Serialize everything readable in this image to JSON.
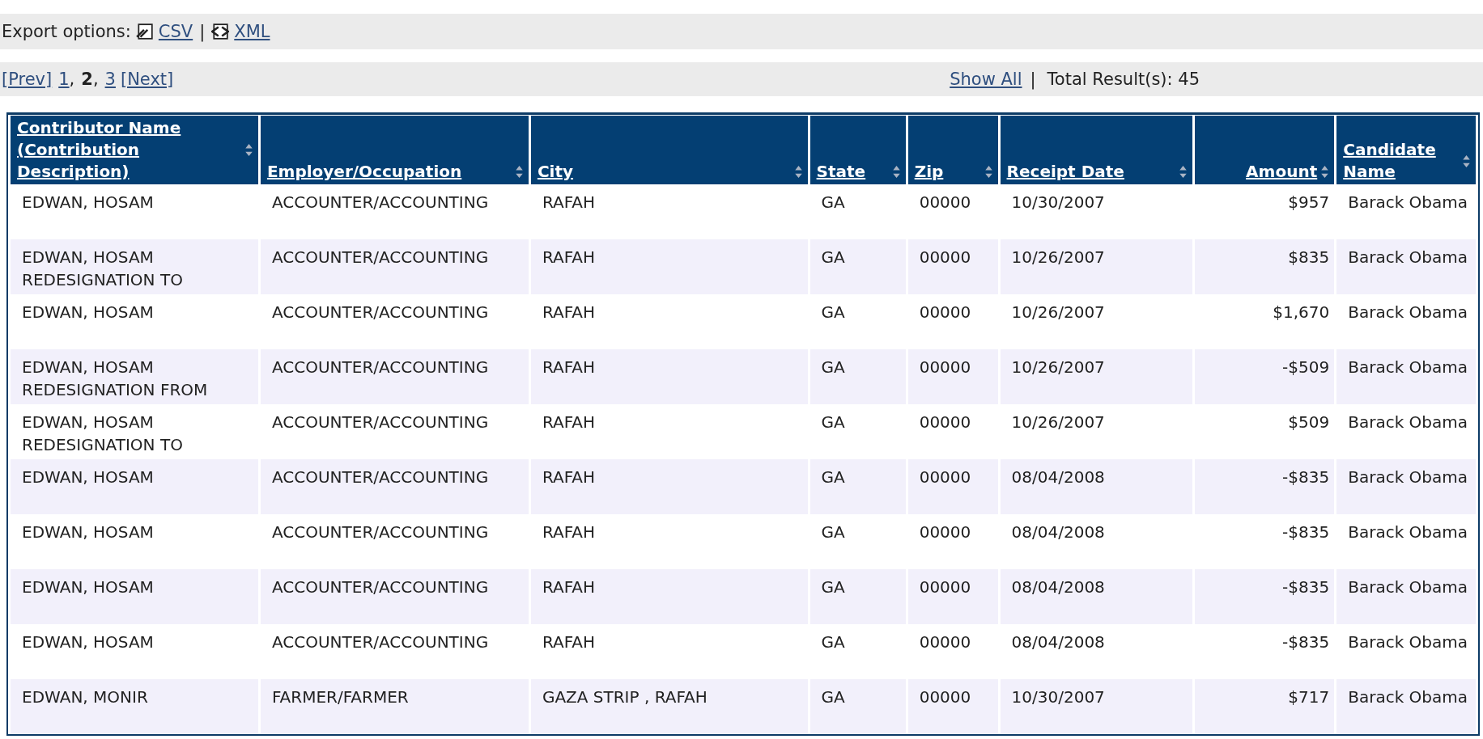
{
  "export_bar": {
    "label": "Export options:",
    "links": [
      {
        "kind": "csv",
        "label": "CSV"
      },
      {
        "kind": "xml",
        "label": "XML"
      }
    ],
    "separator": "|"
  },
  "pager": {
    "prev": "[Prev]",
    "next": "[Next]",
    "page_separator": ",",
    "pages": [
      {
        "label": "1",
        "selected": false
      },
      {
        "label": "2",
        "selected": true
      },
      {
        "label": "3",
        "selected": false
      }
    ],
    "show_all": "Show All",
    "separator": "|",
    "total": "Total Result(s): 45"
  },
  "table": {
    "columns": [
      "Contributor Name (Contribution Description)",
      "Employer/Occupation",
      "City",
      "State",
      "Zip",
      "Receipt Date",
      "Amount",
      "Candidate Name"
    ],
    "rows": [
      [
        "EDWAN, HOSAM",
        "ACCOUNTER/ACCOUNTING",
        "RAFAH",
        "GA",
        "00000",
        "10/30/2007",
        "$957",
        "Barack Obama"
      ],
      [
        "EDWAN, HOSAM REDESIGNATION TO",
        "ACCOUNTER/ACCOUNTING",
        "RAFAH",
        "GA",
        "00000",
        "10/26/2007",
        "$835",
        "Barack Obama"
      ],
      [
        "EDWAN, HOSAM",
        "ACCOUNTER/ACCOUNTING",
        "RAFAH",
        "GA",
        "00000",
        "10/26/2007",
        "$1,670",
        "Barack Obama"
      ],
      [
        "EDWAN, HOSAM REDESIGNATION FROM",
        "ACCOUNTER/ACCOUNTING",
        "RAFAH",
        "GA",
        "00000",
        "10/26/2007",
        "-$509",
        "Barack Obama"
      ],
      [
        "EDWAN, HOSAM REDESIGNATION TO",
        "ACCOUNTER/ACCOUNTING",
        "RAFAH",
        "GA",
        "00000",
        "10/26/2007",
        "$509",
        "Barack Obama"
      ],
      [
        "EDWAN, HOSAM",
        "ACCOUNTER/ACCOUNTING",
        "RAFAH",
        "GA",
        "00000",
        "08/04/2008",
        "-$835",
        "Barack Obama"
      ],
      [
        "EDWAN, HOSAM",
        "ACCOUNTER/ACCOUNTING",
        "RAFAH",
        "GA",
        "00000",
        "08/04/2008",
        "-$835",
        "Barack Obama"
      ],
      [
        "EDWAN, HOSAM",
        "ACCOUNTER/ACCOUNTING",
        "RAFAH",
        "GA",
        "00000",
        "08/04/2008",
        "-$835",
        "Barack Obama"
      ],
      [
        "EDWAN, HOSAM",
        "ACCOUNTER/ACCOUNTING",
        "RAFAH",
        "GA",
        "00000",
        "08/04/2008",
        "-$835",
        "Barack Obama"
      ],
      [
        "EDWAN, MONIR",
        "FARMER/FARMER",
        "GAZA STRIP , RAFAH",
        "GA",
        "00000",
        "10/30/2007",
        "$717",
        "Barack Obama"
      ]
    ]
  }
}
